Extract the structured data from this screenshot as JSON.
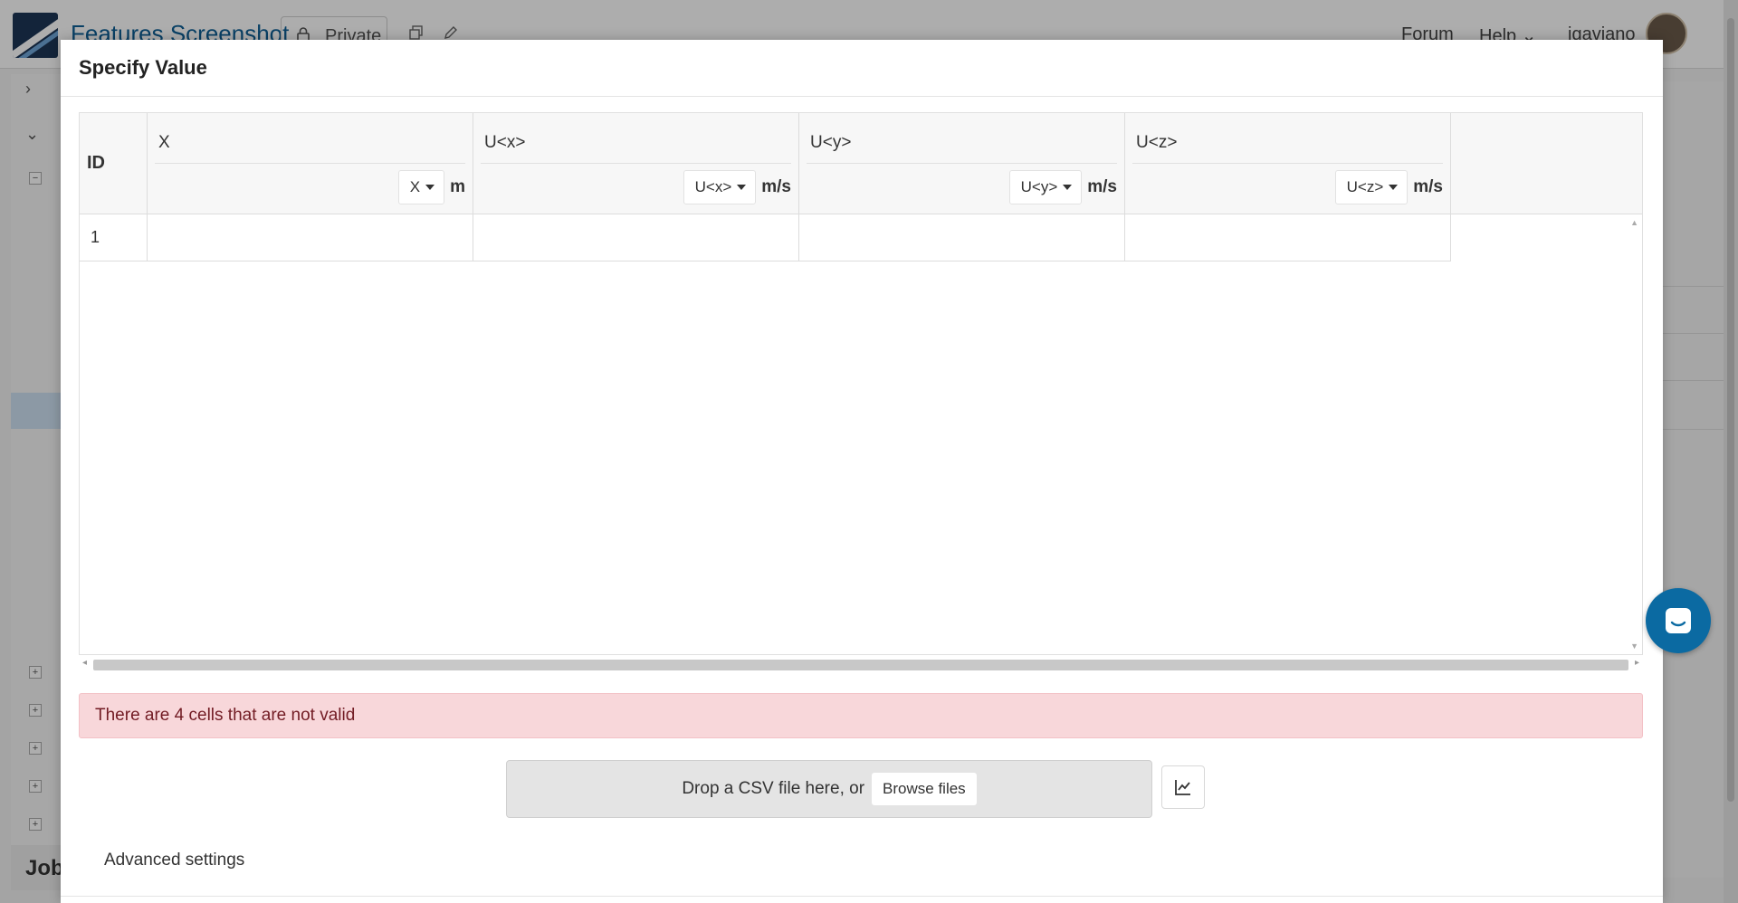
{
  "app": {
    "project_title": "Features Screenshot",
    "visibility": "Private",
    "nav": {
      "forum": "Forum",
      "help": "Help",
      "username": "igaviano"
    },
    "job_label": "Job"
  },
  "modal": {
    "title": "Specify Value",
    "table": {
      "id_header": "ID",
      "columns": [
        {
          "name": "X",
          "unit_select": "X",
          "unit": "m"
        },
        {
          "name": "U<x>",
          "unit_select": "U<x>",
          "unit": "m/s"
        },
        {
          "name": "U<y>",
          "unit_select": "U<y>",
          "unit": "m/s"
        },
        {
          "name": "U<z>",
          "unit_select": "U<z>",
          "unit": "m/s"
        }
      ],
      "rows": [
        {
          "id": "1",
          "cells": [
            "",
            "",
            "",
            ""
          ]
        }
      ]
    },
    "alert": "There are 4 cells that are not valid",
    "dropzone": {
      "text": "Drop a CSV file here, or",
      "browse": "Browse files"
    },
    "advanced_settings": "Advanced settings"
  },
  "icons": {
    "lock": "lock-icon",
    "copy": "copy-icon",
    "edit": "pencil-icon",
    "chart": "line-chart-icon",
    "chat": "chat-icon"
  },
  "colors": {
    "alert_bg": "#f8d7da",
    "alert_text": "#721c24",
    "brand": "#0e5f95",
    "chat": "#0b6aa2"
  }
}
